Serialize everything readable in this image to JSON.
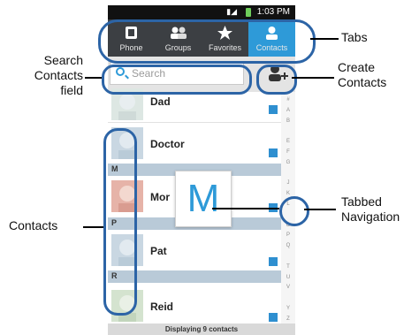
{
  "status": {
    "time": "1:03 PM"
  },
  "tabs": [
    {
      "label": "Phone"
    },
    {
      "label": "Groups"
    },
    {
      "label": "Favorites"
    },
    {
      "label": "Contacts"
    }
  ],
  "search": {
    "placeholder": "Search"
  },
  "contacts": [
    {
      "name": "Dad"
    },
    {
      "name": "Doctor"
    },
    {
      "name": "Mor"
    },
    {
      "name": "Pat"
    },
    {
      "name": "Reid"
    }
  ],
  "sections": [
    "M",
    "P",
    "R"
  ],
  "index_letters": [
    "#",
    "A",
    "B",
    "",
    "E",
    "F",
    "G",
    "",
    "J",
    "K",
    "L",
    "",
    "O",
    "P",
    "Q",
    "",
    "T",
    "U",
    "V",
    "",
    "Y",
    "Z"
  ],
  "popup_letter": "M",
  "footer": "Displaying 9 contacts",
  "annotations": {
    "tabs": "Tabs",
    "search_line1": "Search",
    "search_line2": "Contacts",
    "search_line3": "field",
    "create_line1": "Create",
    "create_line2": "Contacts",
    "contacts": "Contacts",
    "tabbed_line1": "Tabbed",
    "tabbed_line2": "Navigation"
  },
  "colors": {
    "accent": "#2e9ad8",
    "callout_ring": "#2c64a6",
    "section": "#b9cad8"
  }
}
